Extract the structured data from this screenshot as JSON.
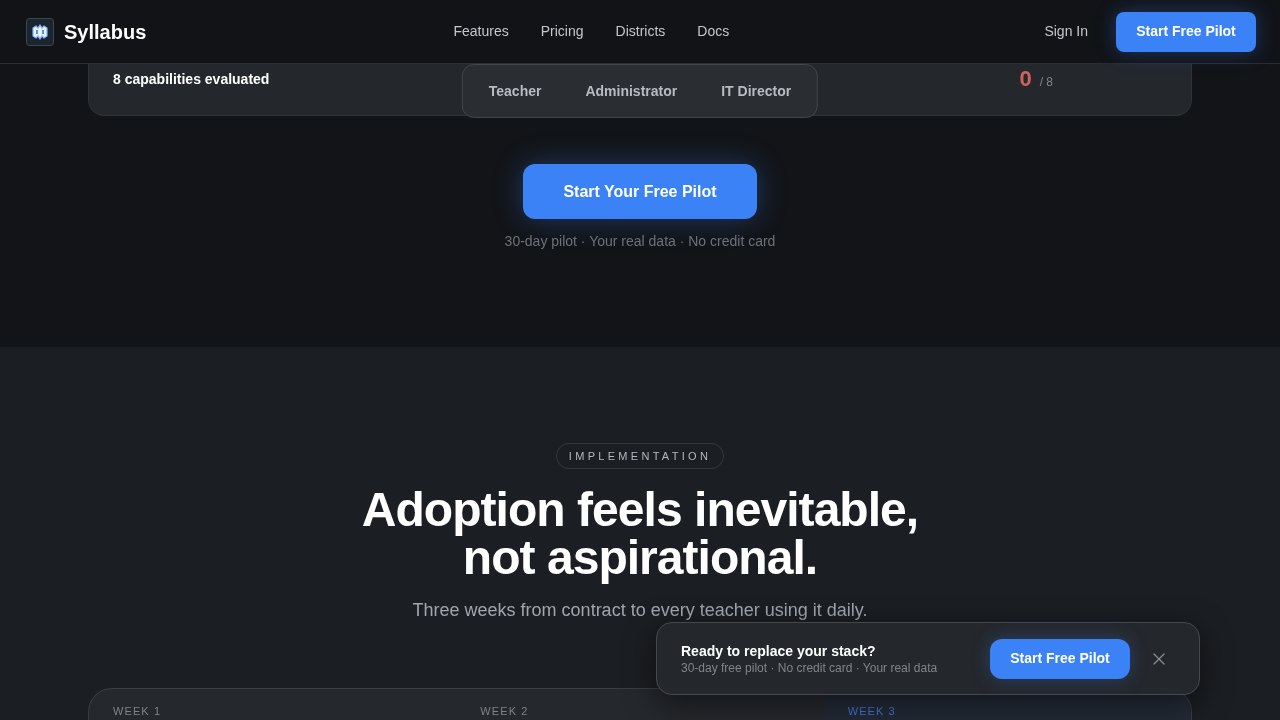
{
  "nav": {
    "brand": "Syllabus",
    "links": [
      "Features",
      "Pricing",
      "Districts",
      "Docs"
    ],
    "sign_in": "Sign In",
    "cta": "Start Free Pilot"
  },
  "comparison": {
    "summary": "8 capabilities evaluated",
    "score": "0",
    "score_total": "/ 8",
    "tabs": [
      {
        "label": "Teacher",
        "selected": false
      },
      {
        "label": "Administrator",
        "selected": false
      },
      {
        "label": "IT Director",
        "selected": false
      }
    ]
  },
  "cta_section": {
    "button": "Start Your Free Pilot",
    "caption": "30-day pilot · Your real data · No credit card"
  },
  "implementation": {
    "badge": "IMPLEMENTATION",
    "heading": "Adoption feels inevitable, not aspirational.",
    "subtitle": "Three weeks from contract to every teacher using it daily.",
    "weeks": [
      {
        "label": "WEEK 1",
        "selected": false
      },
      {
        "label": "WEEK 2",
        "selected": false
      },
      {
        "label": "WEEK 3",
        "selected": true
      }
    ]
  },
  "sticky_banner": {
    "title": "Ready to replace your stack?",
    "subtitle": "30-day free pilot · No credit card · Your real data",
    "button": "Start Free Pilot"
  }
}
